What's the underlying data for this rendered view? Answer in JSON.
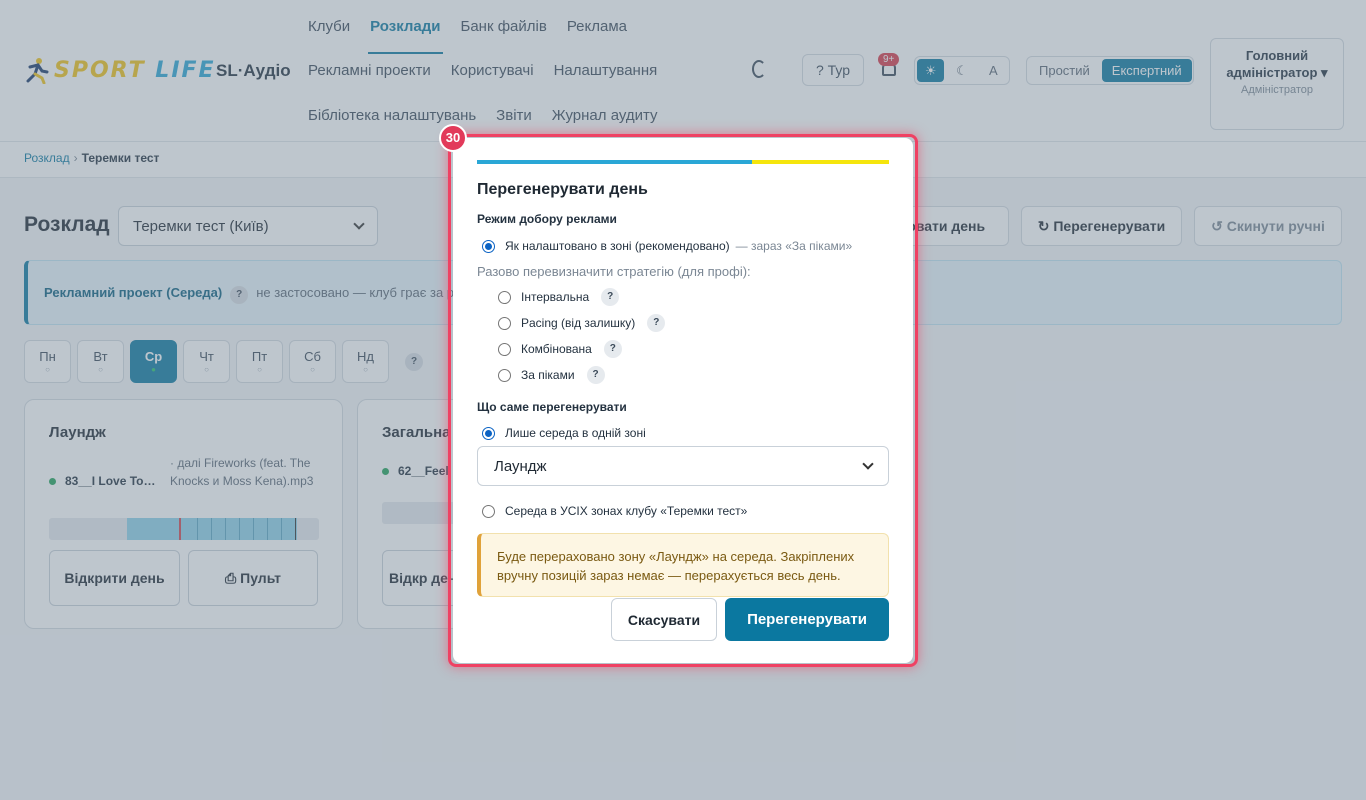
{
  "app": {
    "logo_word1": "SPORT ",
    "logo_word2": "LIFE",
    "name": "SL·Аудіо"
  },
  "nav": {
    "row1": [
      "Клуби",
      "Розклади",
      "Банк файлів",
      "Реклама"
    ],
    "row2": [
      "Рекламні проекти",
      "Користувачі",
      "Налаштування"
    ],
    "row3": [
      "Бібліотека налаштувань",
      "Звіти",
      "Журнал аудиту"
    ],
    "active": "Розклади"
  },
  "header": {
    "tour_label": "? Тур",
    "notif_badge": "9+",
    "theme": {
      "light": "☀",
      "dark": "☾",
      "auto": "A"
    },
    "mode": {
      "simple": "Простий",
      "expert": "Експертний",
      "active": "Експертний"
    },
    "user": {
      "name": "Головний адміністратор ▾",
      "role": "Адміністратор"
    }
  },
  "breadcrumb": {
    "root": "Розклад",
    "sep": "›",
    "current": "Теремки тест"
  },
  "page": {
    "title": "Розклад",
    "club_select": "Теремки тест (Київ)",
    "actions": {
      "regen_day": "ювати день",
      "regen": "↻ Перегенерувати",
      "reset": "↺ Скинути ручні"
    }
  },
  "banner": {
    "title": "Рекламний проект (Середа)",
    "help": "?",
    "text": "не застосовано — клуб грає за р"
  },
  "days": [
    {
      "label": "Пн",
      "mark": "○",
      "active": false
    },
    {
      "label": "Вт",
      "mark": "○",
      "active": false
    },
    {
      "label": "Ср",
      "mark": "●",
      "active": true
    },
    {
      "label": "Чт",
      "mark": "○",
      "active": false
    },
    {
      "label": "Пт",
      "mark": "○",
      "active": false
    },
    {
      "label": "Сб",
      "mark": "○",
      "active": false
    },
    {
      "label": "Нд",
      "mark": "○",
      "active": false
    }
  ],
  "days_help": "?",
  "zones": [
    {
      "title": "Лаундж",
      "track": "83__I Love To…",
      "next": "· далі Fireworks (feat. The Knocks и Moss Kena).mp3",
      "open_day": "Відкрити день",
      "console": "⎙ Пульт"
    },
    {
      "title": "Загальна",
      "track": "62__Feel",
      "open_day": "Відкр день"
    }
  ],
  "modal": {
    "step": "30",
    "title": "Перегенерувати день",
    "mode_heading": "Режим добору реклами",
    "mode_default": "Як налаштовано в зоні (рекомендовано)",
    "mode_default_note": "— зараз «За піками»",
    "override_hint": "Разово перевизначити стратегію (для профі):",
    "strategies": [
      "Інтервальна",
      "Pacing (від залишку)",
      "Комбінована",
      "За піками"
    ],
    "help": "?",
    "scope_heading": "Що саме перегенерувати",
    "scope_one": "Лише середа в одній зоні",
    "zone_select": "Лаундж",
    "scope_all": "Середа в УСІХ зонах клубу «Теремки тест»",
    "warning": "Буде перераховано зону «Лаундж» на середа. Закріплених вручну позицій зараз немає — перерахується весь день.",
    "cancel": "Скасувати",
    "confirm": "Перегенерувати"
  },
  "colors": {
    "accent": "#0b78a0",
    "highlight": "#ef4163",
    "flag_blue": "#2aa7d6",
    "flag_yellow": "#f5e50d"
  }
}
